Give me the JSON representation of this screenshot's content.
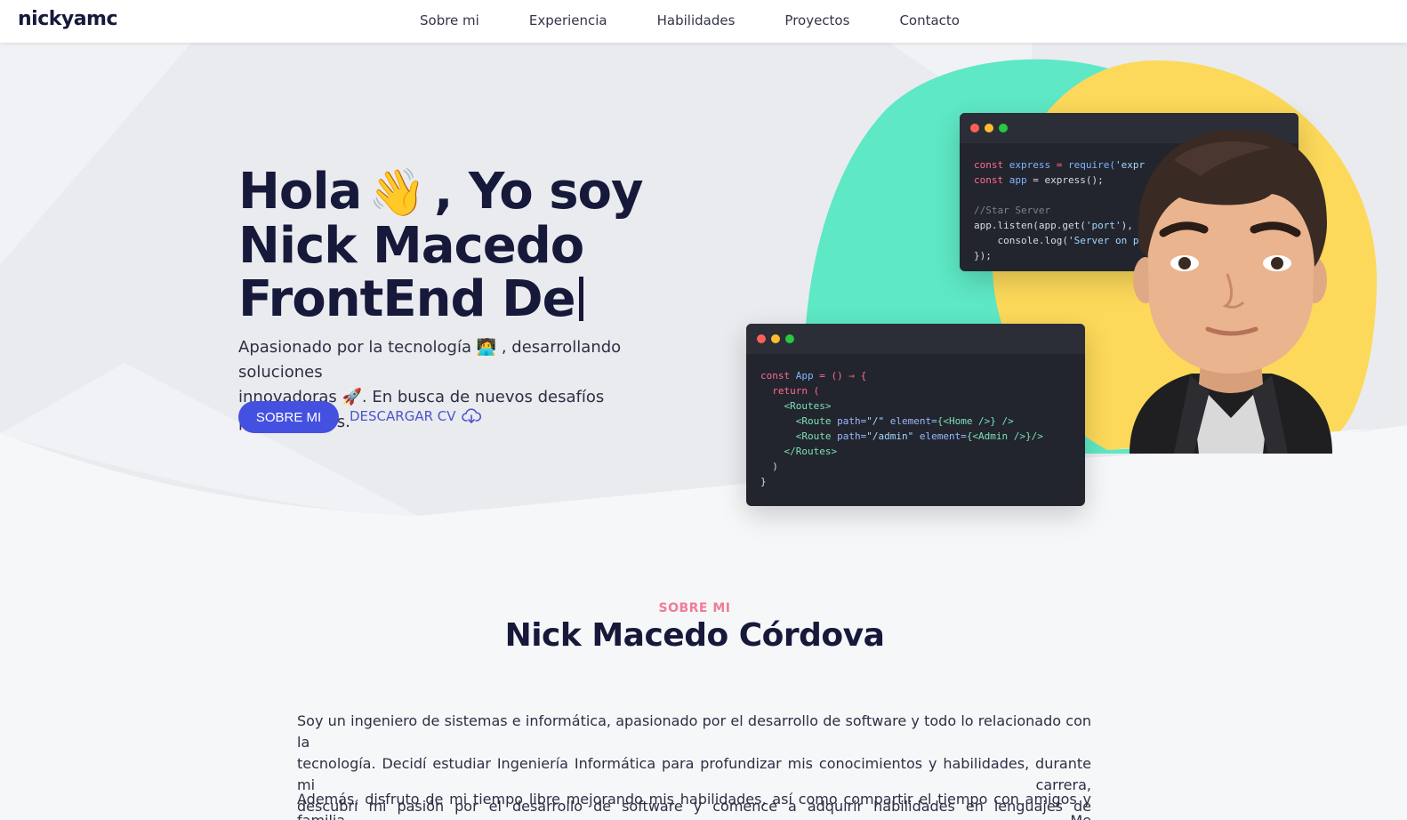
{
  "nav": {
    "logo": "nickyamc",
    "links": [
      "Sobre mi",
      "Experiencia",
      "Habilidades",
      "Proyectos",
      "Contacto"
    ]
  },
  "hero": {
    "line1_pre": "Hola",
    "line1_emoji": "👋",
    "line1_post": ", Yo soy",
    "line2": "Nick Macedo",
    "line3": "FrontEnd De",
    "subtitle_1": "Apasionado por la tecnología 🧑‍💻 , desarrollando soluciones",
    "subtitle_2": "innovadoras 🚀. En busca de nuevos desafíos profesionales.",
    "primary_button": "SOBRE MI",
    "secondary_button": "DESCARGAR CV"
  },
  "code_back": {
    "l1a": "const",
    "l1b": " express ",
    "l1c": "= ",
    "l1d": "require(",
    "l1e": "'expr",
    "l2a": "const",
    "l2b": " app ",
    "l2c": "= express();",
    "l3": "//Star Server",
    "l4a": "app.listen(app.get(",
    "l4b": "'port'",
    "l4c": "),",
    "l5a": "    console.log(",
    "l5b": "'Server on p",
    "l6": "});"
  },
  "code_front": {
    "l1a": "const",
    "l1b": " App ",
    "l1c": "= () ⇒ {",
    "l2": "  return (",
    "l3": "    <Routes>",
    "l4a": "      <Route ",
    "l4b": "path=",
    "l4c": "\"/\"",
    "l4d": " element=",
    "l4e": "{<Home />} />",
    "l5a": "      <Route ",
    "l5b": "path=",
    "l5c": "\"/admin\"",
    "l5d": " element=",
    "l5e": "{<Admin />}/>",
    "l6": "    </Routes>",
    "l7": "  )",
    "l8": "}"
  },
  "about": {
    "eyebrow": "SOBRE MI",
    "title": "Nick Macedo Córdova",
    "p1_l1": "Soy un ingeniero de sistemas e informática, apasionado por el desarrollo de software y todo lo relacionado con la",
    "p1_l2": "tecnología. Decidí estudiar Ingeniería Informática para profundizar mis conocimientos y habilidades, durante mi carrera,",
    "p1_l3": "descubrí mi pasión por el desarrollo de software y comencé a adquirir habilidades en lenguajes de programación.",
    "p2_l1": "Además, disfruto de mi tiempo libre mejorando mis habilidades, así como compartir el tiempo con amigos y familia. Me"
  },
  "colors": {
    "accent": "#4450e0",
    "eyebrow": "#f07d96",
    "blob_green": "#5ee8c5",
    "blob_yellow": "#fcd95a"
  }
}
